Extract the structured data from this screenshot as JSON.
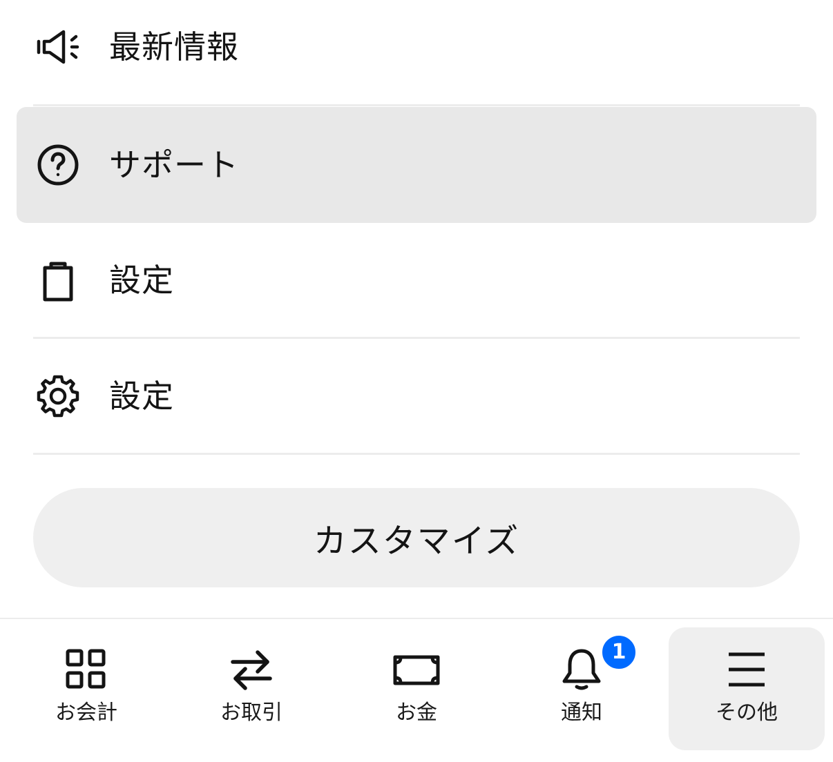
{
  "menu": {
    "items": [
      {
        "label": "最新情報",
        "icon": "megaphone-icon",
        "highlighted": false
      },
      {
        "label": "サポート",
        "icon": "help-circle-icon",
        "highlighted": true
      },
      {
        "label": "設定",
        "icon": "clipboard-icon",
        "highlighted": false
      },
      {
        "label": "設定",
        "icon": "gear-icon",
        "highlighted": false
      }
    ]
  },
  "customize_button": {
    "label": "カスタマイズ"
  },
  "bottom_nav": {
    "items": [
      {
        "label": "お会計",
        "icon": "grid-icon",
        "active": false
      },
      {
        "label": "お取引",
        "icon": "swap-arrows-icon",
        "active": false
      },
      {
        "label": "お金",
        "icon": "banknote-icon",
        "active": false
      },
      {
        "label": "通知",
        "icon": "bell-icon",
        "active": false,
        "badge": "1"
      },
      {
        "label": "その他",
        "icon": "menu-icon",
        "active": true
      }
    ]
  },
  "colors": {
    "badge": "#006aff",
    "highlight": "#e8e8e8",
    "button_bg": "#efefef",
    "text": "#141414"
  }
}
